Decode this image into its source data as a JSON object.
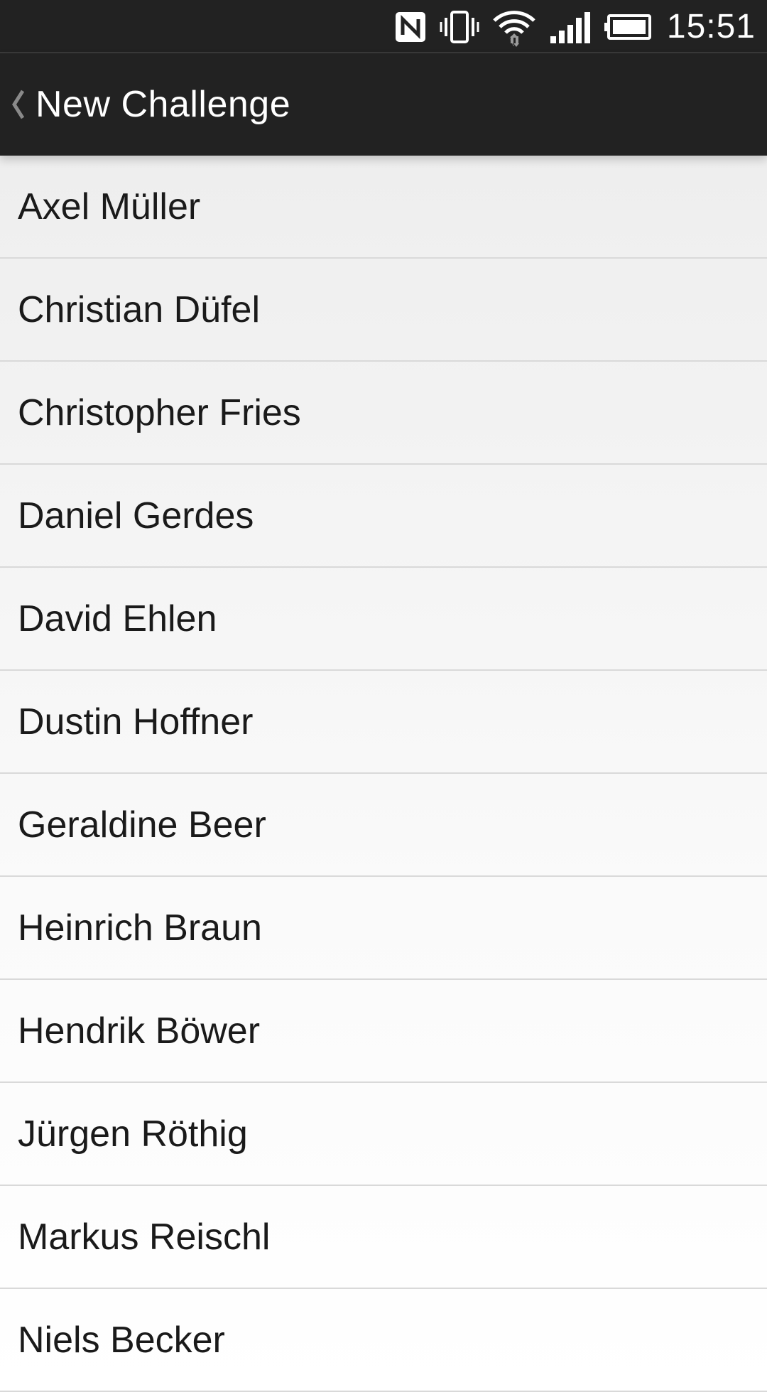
{
  "status_bar": {
    "time": "15:51",
    "icons": [
      "nfc-icon",
      "vibrate-icon",
      "wifi-icon",
      "signal-icon",
      "battery-icon"
    ]
  },
  "action_bar": {
    "back_icon": "chevron-left-icon",
    "title": "New Challenge"
  },
  "contacts": [
    {
      "name": "Axel Müller"
    },
    {
      "name": "Christian Düfel"
    },
    {
      "name": "Christopher Fries"
    },
    {
      "name": "Daniel Gerdes"
    },
    {
      "name": "David Ehlen"
    },
    {
      "name": "Dustin Hoffner"
    },
    {
      "name": "Geraldine Beer"
    },
    {
      "name": "Heinrich Braun"
    },
    {
      "name": "Hendrik Böwer"
    },
    {
      "name": "Jürgen Röthig"
    },
    {
      "name": "Markus Reischl"
    },
    {
      "name": "Niels Becker"
    }
  ],
  "colors": {
    "bar_background": "#222222",
    "list_background": "#f6f6f6",
    "divider": "#d9d9d9",
    "text": "#1a1a1a"
  }
}
